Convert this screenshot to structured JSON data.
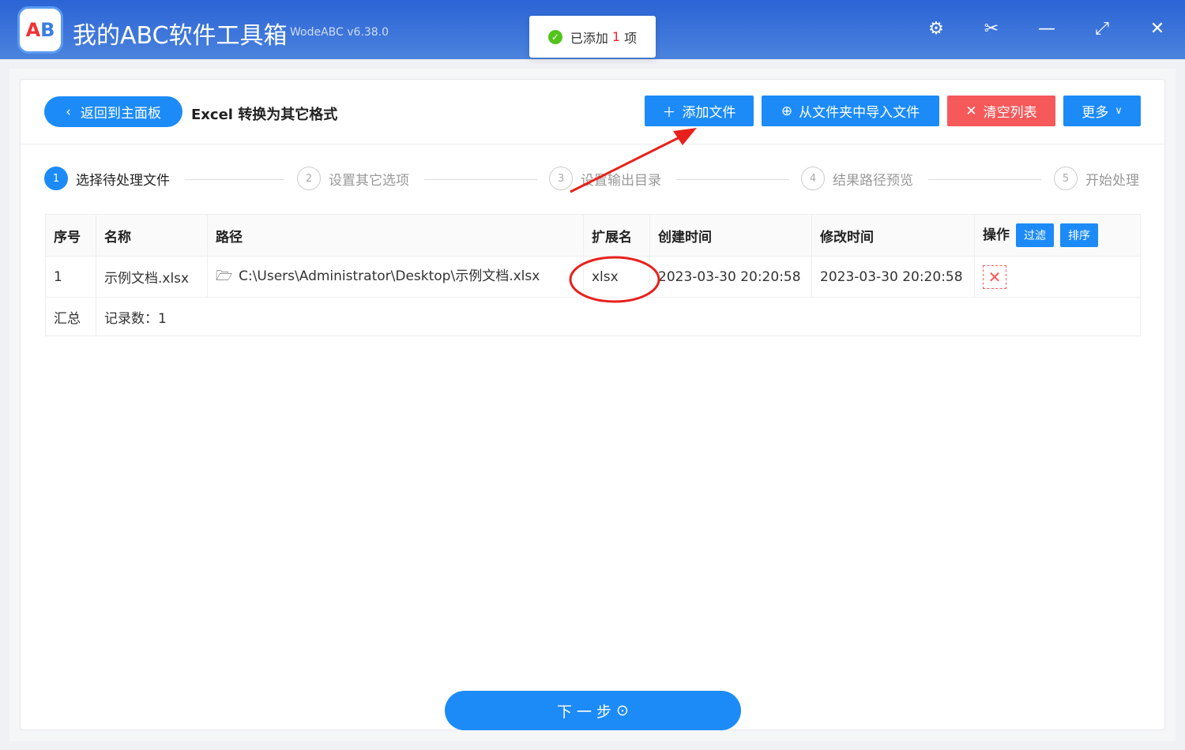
{
  "app": {
    "title": "我的ABC软件工具箱",
    "version": "WodeABC v6.38.0",
    "logo_text": "AB"
  },
  "window": {
    "settings": "⚙",
    "cut": "✂",
    "minimize": "—",
    "maximize": "⤢",
    "close": "✕"
  },
  "toast": {
    "prefix": "已添加",
    "count": "1",
    "suffix": "项"
  },
  "header": {
    "back": "返回到主面板",
    "page_title": "Excel 转换为其它格式",
    "add_file": "添加文件",
    "import_folder": "从文件夹中导入文件",
    "clear_list": "清空列表",
    "more": "更多"
  },
  "steps": [
    {
      "num": "1",
      "label": "选择待处理文件"
    },
    {
      "num": "2",
      "label": "设置其它选项"
    },
    {
      "num": "3",
      "label": "设置输出目录"
    },
    {
      "num": "4",
      "label": "结果路径预览"
    },
    {
      "num": "5",
      "label": "开始处理"
    }
  ],
  "table": {
    "headers": [
      "序号",
      "名称",
      "路径",
      "扩展名",
      "创建时间",
      "修改时间",
      "操作"
    ],
    "filter": "过滤",
    "sort": "排序",
    "rows": [
      {
        "index": "1",
        "name": "示例文档.xlsx",
        "path": "C:\\Users\\Administrator\\Desktop\\示例文档.xlsx",
        "ext": "xlsx",
        "created": "2023-03-30 20:20:58",
        "modified": "2023-03-30 20:20:58"
      }
    ],
    "summary_label": "汇总",
    "summary_value": "记录数：1"
  },
  "next": "下一步",
  "colors": {
    "primary": "#1c8bf8",
    "danger": "#f5595a",
    "annotation": "#e8201c"
  }
}
